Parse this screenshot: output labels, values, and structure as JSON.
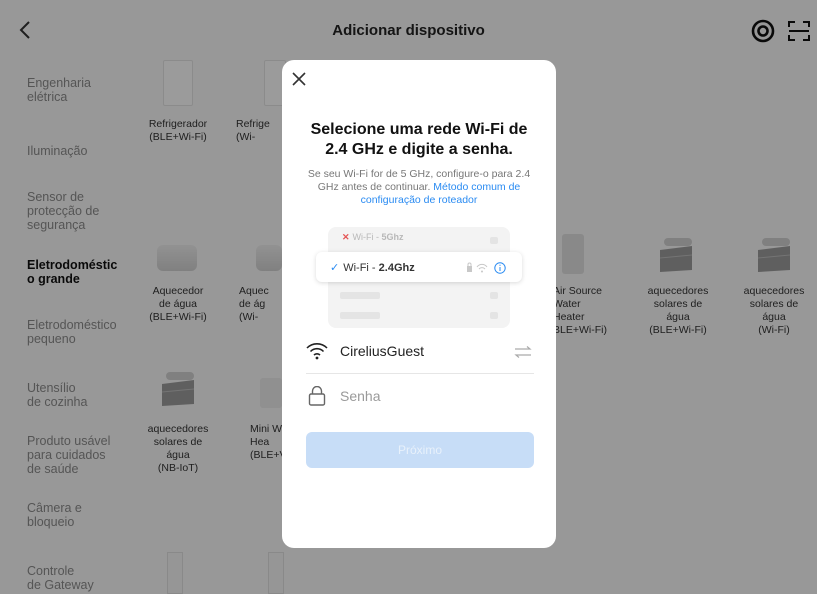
{
  "header": {
    "title": "Adicionar dispositivo"
  },
  "sidebar": {
    "items": [
      {
        "label": "Engenharia\nelétrica"
      },
      {
        "label": "Iluminação"
      },
      {
        "label": "Sensor de\nprotecção de\nsegurança"
      },
      {
        "label": "Eletrodoméstic\no grande"
      },
      {
        "label": "Eletrodoméstico\npequeno"
      },
      {
        "label": "Utensílio\nde cozinha"
      },
      {
        "label": "Produto usável\npara cuidados\nde saúde"
      },
      {
        "label": "Câmera e\nbloqueio"
      },
      {
        "label": "Controle\nde Gateway"
      }
    ]
  },
  "devices": {
    "fridge_ble": "Refrigerador\n(BLE+Wi-Fi)",
    "fridge_wifi": "Refrige\n(Wi-",
    "heater_ble": "Aquecedor\nde água\n(BLE+Wi-Fi)",
    "heater_wifi": "Aquec\nde ág\n(Wi-",
    "air_source": "Air Source\nWater\nHeater\nBLE+Wi-Fi)",
    "solar_ble": "aquecedores\nsolares de\nágua\n(BLE+Wi-Fi)",
    "solar_wifi": "aquecedores\nsolares de\nágua\n(Wi-Fi)",
    "solar_nbiot": "aquecedores\nsolares de\nágua\n(NB-IoT)",
    "mini_heater": "Mini W\nHea\n(BLE+V"
  },
  "modal": {
    "title": "Selecione uma rede Wi-Fi de 2.4 GHz e digite a senha.",
    "desc_text": "Se seu Wi-Fi for de 5 GHz, configure-o para 2.4 GHz antes de continuar.",
    "desc_link": "Método comum de configuração de roteador",
    "wifi_bad_prefix": "Wi-Fi - ",
    "wifi_bad_band": "5Ghz",
    "wifi_good_prefix": "Wi-Fi - ",
    "wifi_good_band": "2.4Ghz",
    "ssid": "CireliusGuest",
    "password_placeholder": "Senha",
    "next_label": "Próximo"
  },
  "colors": {
    "accent": "#2a8bf2",
    "button_disabled": "#c7ddf7",
    "error": "#e45555"
  }
}
